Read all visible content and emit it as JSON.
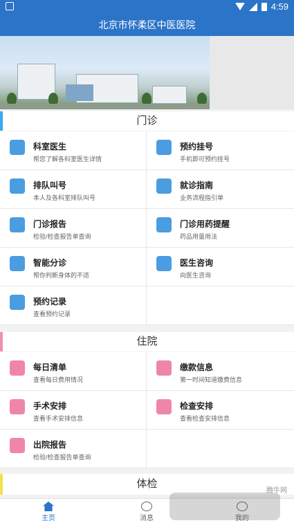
{
  "status_bar": {
    "time": "4:59"
  },
  "title": "北京市怀柔区中医医院",
  "sections": {
    "outpatient": {
      "title": "门诊",
      "color": "#38a9f0",
      "items": [
        {
          "title": "科室医生",
          "sub": "帮您了解各科室医生详情",
          "icon": "doctor-icon"
        },
        {
          "title": "预约挂号",
          "sub": "手机即可预约挂号",
          "icon": "phone-booking-icon"
        },
        {
          "title": "排队叫号",
          "sub": "本人及各科室排队叫号",
          "icon": "queue-people-icon"
        },
        {
          "title": "就诊指南",
          "sub": "业务流程指引单",
          "icon": "signpost-icon"
        },
        {
          "title": "门诊报告",
          "sub": "检验/检查报告单查询",
          "icon": "report-icon"
        },
        {
          "title": "门诊用药提醒",
          "sub": "药品用量用法",
          "icon": "medicine-icon"
        },
        {
          "title": "智能分诊",
          "sub": "帮你判断身体的不适",
          "icon": "triage-icon"
        },
        {
          "title": "医生咨询",
          "sub": "向医生咨询",
          "icon": "consult-icon"
        },
        {
          "title": "预约记录",
          "sub": "查看预约记录",
          "icon": "booking-record-icon"
        }
      ]
    },
    "inpatient": {
      "title": "住院",
      "color": "#f28fb1",
      "items": [
        {
          "title": "每日清单",
          "sub": "查看每日费用情况",
          "icon": "daily-bill-icon"
        },
        {
          "title": "缴款信息",
          "sub": "第一时间知道缴费信息",
          "icon": "wallet-icon"
        },
        {
          "title": "手术安排",
          "sub": "查看手术安排信息",
          "icon": "surgery-icon"
        },
        {
          "title": "检查安排",
          "sub": "查看检查安排信息",
          "icon": "exam-icon"
        },
        {
          "title": "出院报告",
          "sub": "检验/检查报告单查询",
          "icon": "discharge-report-icon"
        }
      ]
    },
    "physical_exam": {
      "title": "体检",
      "color": "#f2e24a"
    }
  },
  "bottom_nav": {
    "home": "主页",
    "messages": "消息",
    "third": "我的"
  },
  "watermark": "腾牛网"
}
